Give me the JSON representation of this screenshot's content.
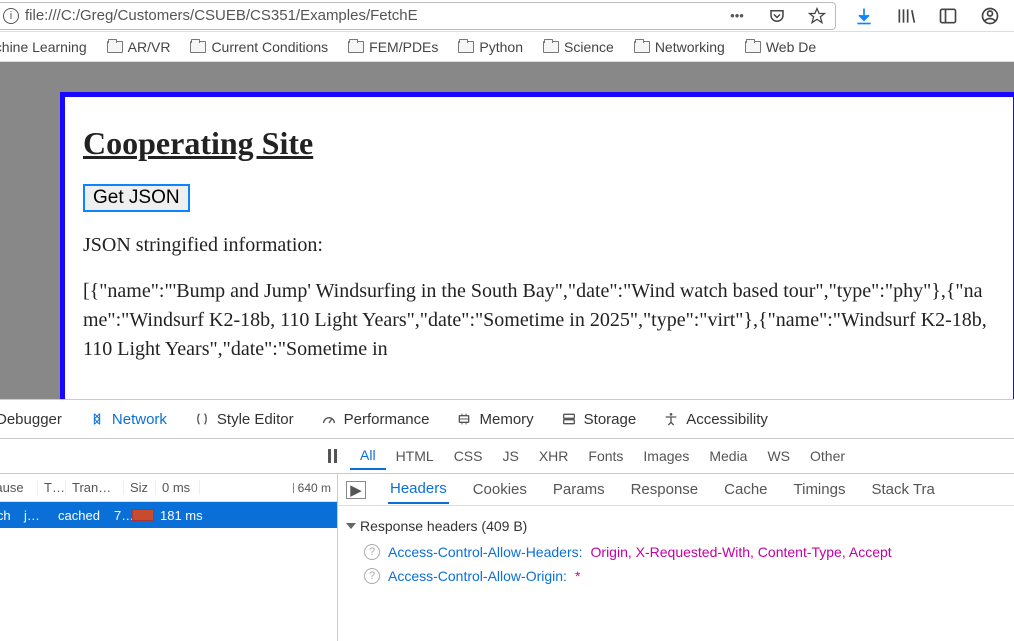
{
  "address": {
    "url": "file:///C:/Greg/Customers/CSUEB/CS351/Examples/FetchE"
  },
  "bookmarks": [
    "achine Learning",
    "AR/VR",
    "Current Conditions",
    "FEM/PDEs",
    "Python",
    "Science",
    "Networking",
    "Web De"
  ],
  "page": {
    "title": "Cooperating Site",
    "button": "Get JSON",
    "label": "JSON stringified information:",
    "json": "[{\"name\":\"'Bump and Jump' Windsurfing in the South Bay\",\"date\":\"Wind watch based tour\",\"type\":\"phy\"},{\"name\":\"Windsurf K2-18b, 110 Light Years\",\"date\":\"Sometime in 2025\",\"type\":\"virt\"},{\"name\":\"Windsurf K2-18b, 110 Light Years\",\"date\":\"Sometime in"
  },
  "devtools": {
    "tabs": {
      "debugger": "Debugger",
      "network": "Network",
      "style": "Style Editor",
      "perf": "Performance",
      "memory": "Memory",
      "storage": "Storage",
      "access": "Accessibility"
    },
    "filters": {
      "all": "All",
      "html": "HTML",
      "css": "CSS",
      "js": "JS",
      "xhr": "XHR",
      "fonts": "Fonts",
      "images": "Images",
      "media": "Media",
      "ws": "WS",
      "other": "Other"
    },
    "net_head": {
      "cause": "Cause",
      "type": "T…",
      "transf": "Transf…",
      "size": "Siz",
      "zero": "0 ms",
      "t640": "640 m"
    },
    "net_row": {
      "name": "etch",
      "type": "js…",
      "transf": "cached",
      "size": "7…",
      "time": "181 ms"
    },
    "detail_tabs": {
      "headers": "Headers",
      "cookies": "Cookies",
      "params": "Params",
      "response": "Response",
      "cache": "Cache",
      "timings": "Timings",
      "stack": "Stack Tra"
    },
    "resp_section": "Response headers (409 B)",
    "hdrs": {
      "h1_name": "Access-Control-Allow-Headers:",
      "h1_val": "Origin, X-Requested-With, Content-Type, Accept",
      "h2_name": "Access-Control-Allow-Origin:",
      "h2_val": "*"
    }
  }
}
